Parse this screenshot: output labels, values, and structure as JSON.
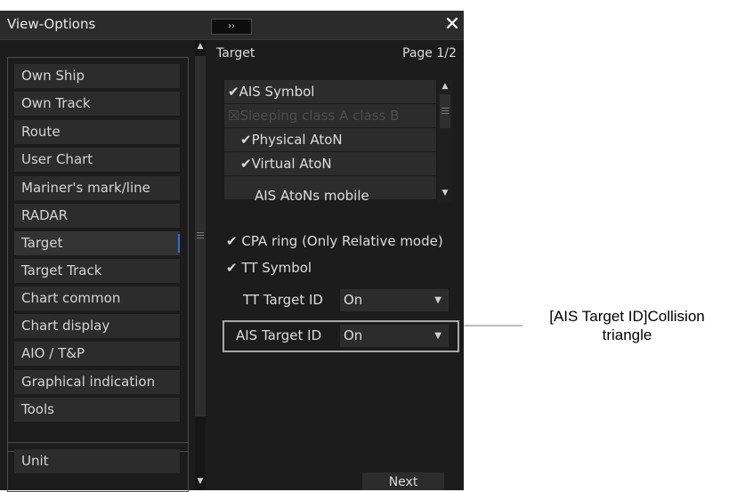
{
  "window": {
    "title": "View-Options",
    "expand_symbol": "››",
    "close_symbol": "✕"
  },
  "left_menu": {
    "items": [
      {
        "label": "Own Ship"
      },
      {
        "label": "Own Track"
      },
      {
        "label": "Route"
      },
      {
        "label": "User Chart"
      },
      {
        "label": "Mariner's mark/line"
      },
      {
        "label": "RADAR"
      },
      {
        "label": "Target",
        "active": true
      },
      {
        "label": "Target Track"
      },
      {
        "label": "Chart common"
      },
      {
        "label": "Chart display"
      },
      {
        "label": "AIO / T&P"
      },
      {
        "label": "Graphical indication"
      },
      {
        "label": "Tools"
      }
    ],
    "unit_label": "Unit"
  },
  "right_panel": {
    "title": "Target",
    "page": "Page 1/2",
    "ais_list": [
      {
        "label": "AIS Symbol",
        "mark": "✔",
        "disabled": false
      },
      {
        "label": "Sleeping class A class B",
        "mark": "☒",
        "disabled": true
      },
      {
        "label": "Physical AtoN",
        "mark": "✔",
        "disabled": false
      },
      {
        "label": "Virtual AtoN",
        "mark": "✔",
        "disabled": false
      },
      {
        "label": "AIS AtoNs mobile",
        "mark": "",
        "disabled": false
      }
    ],
    "cpa_ring_label": "CPA ring (Only Relative mode)",
    "cpa_ring_mark": "✔",
    "tt_symbol_label": "TT Symbol",
    "tt_symbol_mark": "✔",
    "tt_target_id_label": "TT Target ID",
    "tt_target_id_value": "On",
    "ais_target_id_label": "AIS Target ID",
    "ais_target_id_value": "On",
    "next_label": "Next"
  },
  "callout": {
    "text": "[AIS Target ID]Collision triangle"
  },
  "colors": {
    "background": "#1c1c1c",
    "item": "#2c2c2c",
    "accent": "#2f6fd8",
    "text": "#dcdcdc"
  }
}
